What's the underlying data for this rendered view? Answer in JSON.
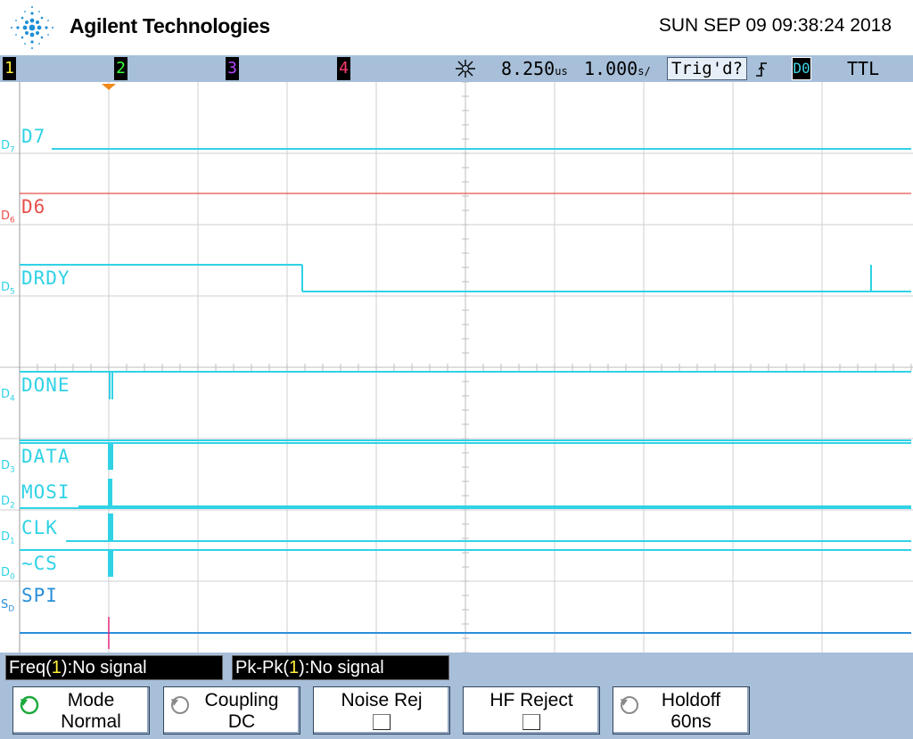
{
  "header": {
    "brand": "Agilent Technologies",
    "datetime": "SUN SEP 09 09:38:24 2018",
    "logo_icon": "agilent-spark-logo-icon"
  },
  "status": {
    "channels": [
      {
        "label": "1",
        "color": "#ffef3a"
      },
      {
        "label": "2",
        "color": "#3aff3a"
      },
      {
        "label": "3",
        "color": "#b347ff"
      },
      {
        "label": "4",
        "color": "#ff3a6e"
      }
    ],
    "run_icon": "acquisition-star-icon",
    "time_position": "8.250",
    "time_position_unit": "us",
    "time_base": "1.000",
    "time_base_unit": "s/",
    "trigger_status": "Trig'd?",
    "trigger_edge_icon": "rising-edge-icon",
    "trigger_source": "D0",
    "logic_level": "TTL"
  },
  "digital_channels": [
    {
      "badge": "D",
      "sub": "7",
      "name": "D7",
      "color": "#30d2e6"
    },
    {
      "badge": "D",
      "sub": "6",
      "name": "D6",
      "color": "#e6504b"
    },
    {
      "badge": "D",
      "sub": "5",
      "name": "DRDY",
      "color": "#30d2e6"
    },
    {
      "badge": "D",
      "sub": "4",
      "name": "DONE",
      "color": "#30d2e6"
    },
    {
      "badge": "D",
      "sub": "3",
      "name": "DATA",
      "color": "#30d2e6"
    },
    {
      "badge": "D",
      "sub": "2",
      "name": "MOSI",
      "color": "#30d2e6"
    },
    {
      "badge": "D",
      "sub": "1",
      "name": "CLK",
      "color": "#30d2e6"
    },
    {
      "badge": "D",
      "sub": "0",
      "name": "~CS",
      "color": "#30d2e6"
    },
    {
      "badge": "S",
      "sub": "D",
      "name": "SPI",
      "color": "#2a8fd8"
    }
  ],
  "measurements": [
    {
      "label": "Freq(",
      "channel": "1",
      "rest": "):No signal"
    },
    {
      "label": "Pk-Pk(",
      "channel": "1",
      "rest": "):No signal"
    }
  ],
  "softkeys": [
    {
      "line1": "Mode",
      "line2": "Normal",
      "icon": "rotate-knob-icon",
      "icon_color": "#1aa83a"
    },
    {
      "line1": "Coupling",
      "line2": "DC",
      "icon": "rotate-knob-icon",
      "icon_color": "#8a8a8a"
    },
    {
      "line1": "Noise Rej",
      "line2": "",
      "checkbox": true
    },
    {
      "line1": "HF Reject",
      "line2": "",
      "checkbox": true
    },
    {
      "line1": "Holdoff",
      "line2": "60ns",
      "icon": "rotate-knob-icon",
      "icon_color": "#8a8a8a"
    }
  ],
  "colors": {
    "bar_background": "#a7bfd9",
    "trace_cyan": "#30d2e6",
    "trace_red": "#e6504b",
    "spi_blue": "#2a8fd8",
    "trigger_marker": "#f08a1c"
  }
}
